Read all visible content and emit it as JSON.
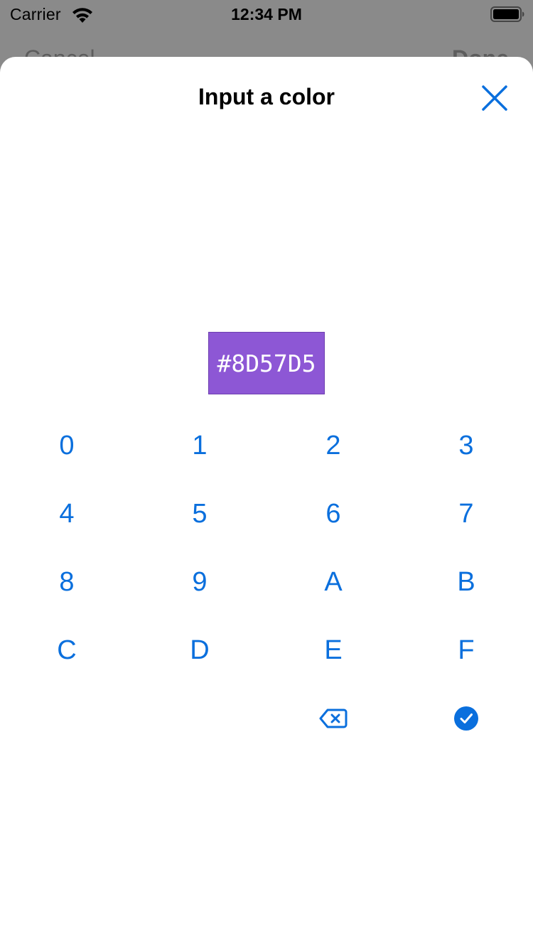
{
  "status_bar": {
    "carrier": "Carrier",
    "time": "12:34 PM"
  },
  "behind": {
    "cancel_label": "Cancel",
    "done_label": "Done"
  },
  "sheet": {
    "title": "Input a color",
    "close_icon": "close-icon"
  },
  "color": {
    "hex": "#8D57D5",
    "swatch_color": "#8D57D5"
  },
  "keypad": {
    "keys": [
      "0",
      "1",
      "2",
      "3",
      "4",
      "5",
      "6",
      "7",
      "8",
      "9",
      "A",
      "B",
      "C",
      "D",
      "E",
      "F"
    ],
    "backspace_icon": "backspace-icon",
    "confirm_icon": "checkmark-circle-icon"
  },
  "accent_color": "#0A6FDD"
}
